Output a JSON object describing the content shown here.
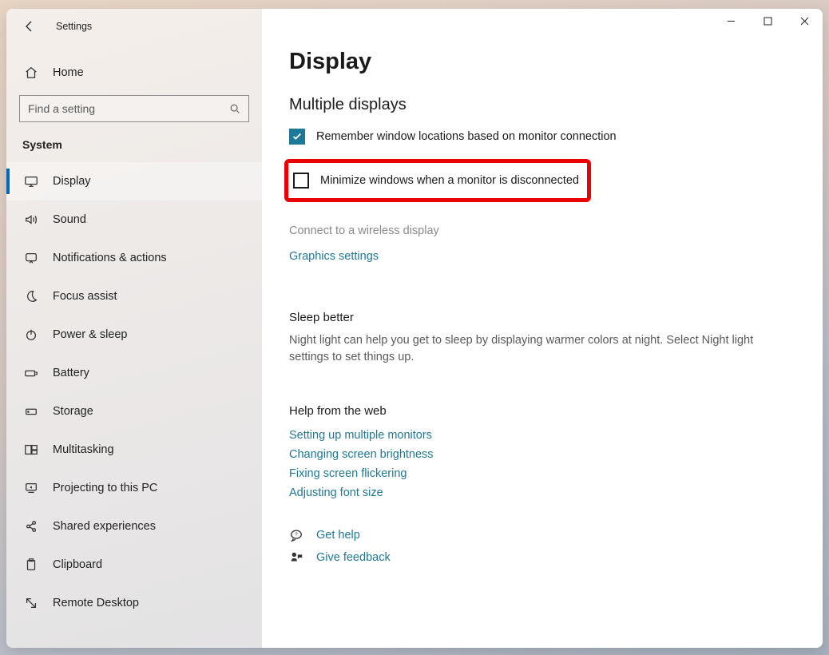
{
  "app": {
    "title": "Settings"
  },
  "home": {
    "label": "Home"
  },
  "search": {
    "placeholder": "Find a setting"
  },
  "section": {
    "label": "System"
  },
  "nav": {
    "items": [
      {
        "key": "display",
        "label": "Display",
        "icon": "monitor-icon",
        "selected": true
      },
      {
        "key": "sound",
        "label": "Sound",
        "icon": "speaker-icon"
      },
      {
        "key": "notifications",
        "label": "Notifications & actions",
        "icon": "notification-icon"
      },
      {
        "key": "focus",
        "label": "Focus assist",
        "icon": "moon-icon"
      },
      {
        "key": "power",
        "label": "Power & sleep",
        "icon": "power-icon"
      },
      {
        "key": "battery",
        "label": "Battery",
        "icon": "battery-icon"
      },
      {
        "key": "storage",
        "label": "Storage",
        "icon": "storage-icon"
      },
      {
        "key": "multitask",
        "label": "Multitasking",
        "icon": "multitask-icon"
      },
      {
        "key": "project",
        "label": "Projecting to this PC",
        "icon": "project-icon"
      },
      {
        "key": "shared",
        "label": "Shared experiences",
        "icon": "shared-icon"
      },
      {
        "key": "clipboard",
        "label": "Clipboard",
        "icon": "clipboard-icon"
      },
      {
        "key": "remote",
        "label": "Remote Desktop",
        "icon": "remote-icon"
      }
    ]
  },
  "page": {
    "title": "Display",
    "multi_head": "Multiple displays",
    "check1": {
      "label": "Remember window locations based on monitor connection",
      "checked": true
    },
    "check2": {
      "label": "Minimize windows when a monitor is disconnected",
      "checked": false
    },
    "wireless_link": "Connect to a wireless display",
    "graphics_link": "Graphics settings",
    "sleep_title": "Sleep better",
    "sleep_body": "Night light can help you get to sleep by displaying warmer colors at night. Select Night light settings to set things up.",
    "help_title": "Help from the web",
    "help_links": [
      "Setting up multiple monitors",
      "Changing screen brightness",
      "Fixing screen flickering",
      "Adjusting font size"
    ],
    "get_help": "Get help",
    "feedback": "Give feedback"
  },
  "colors": {
    "accent": "#1e7898",
    "highlight": "#e80202",
    "nav_marker": "#0067c0"
  }
}
